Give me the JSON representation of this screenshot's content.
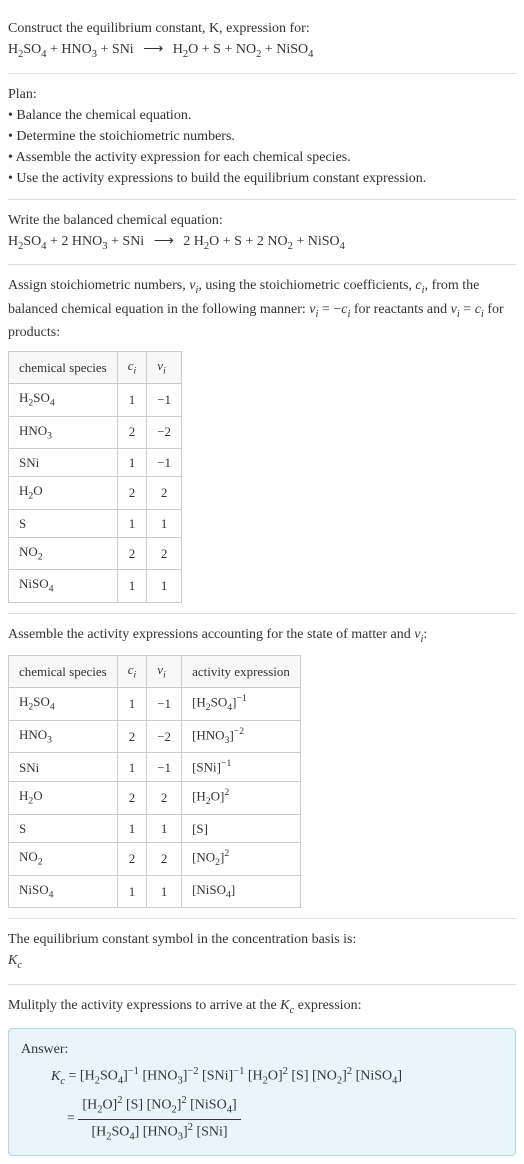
{
  "section1": {
    "line1": "Construct the equilibrium constant, K, expression for:",
    "equation_lhs": "H₂SO₄ + HNO₃ + SNi",
    "equation_rhs": "H₂O + S + NO₂ + NiSO₄"
  },
  "section2": {
    "title": "Plan:",
    "items": [
      "Balance the chemical equation.",
      "Determine the stoichiometric numbers.",
      "Assemble the activity expression for each chemical species.",
      "Use the activity expressions to build the equilibrium constant expression."
    ]
  },
  "section3": {
    "title": "Write the balanced chemical equation:",
    "equation_lhs": "H₂SO₄ + 2 HNO₃ + SNi",
    "equation_rhs": "2 H₂O + S + 2 NO₂ + NiSO₄"
  },
  "section4": {
    "text": "Assign stoichiometric numbers, νᵢ, using the stoichiometric coefficients, cᵢ, from the balanced chemical equation in the following manner: νᵢ = −cᵢ for reactants and νᵢ = cᵢ for products:",
    "headers": [
      "chemical species",
      "cᵢ",
      "νᵢ"
    ],
    "rows": [
      [
        "H₂SO₄",
        "1",
        "−1"
      ],
      [
        "HNO₃",
        "2",
        "−2"
      ],
      [
        "SNi",
        "1",
        "−1"
      ],
      [
        "H₂O",
        "2",
        "2"
      ],
      [
        "S",
        "1",
        "1"
      ],
      [
        "NO₂",
        "2",
        "2"
      ],
      [
        "NiSO₄",
        "1",
        "1"
      ]
    ]
  },
  "section5": {
    "text": "Assemble the activity expressions accounting for the state of matter and νᵢ:",
    "headers": [
      "chemical species",
      "cᵢ",
      "νᵢ",
      "activity expression"
    ],
    "rows": [
      [
        "H₂SO₄",
        "1",
        "−1",
        "[H₂SO₄]⁻¹"
      ],
      [
        "HNO₃",
        "2",
        "−2",
        "[HNO₃]⁻²"
      ],
      [
        "SNi",
        "1",
        "−1",
        "[SNi]⁻¹"
      ],
      [
        "H₂O",
        "2",
        "2",
        "[H₂O]²"
      ],
      [
        "S",
        "1",
        "1",
        "[S]"
      ],
      [
        "NO₂",
        "2",
        "2",
        "[NO₂]²"
      ],
      [
        "NiSO₄",
        "1",
        "1",
        "[NiSO₄]"
      ]
    ]
  },
  "section6": {
    "text": "The equilibrium constant symbol in the concentration basis is:",
    "symbol": "K𝒸"
  },
  "section7": {
    "text": "Mulitply the activity expressions to arrive at the K𝒸 expression:"
  },
  "answer": {
    "label": "Answer:",
    "line1_lhs": "K𝒸 = ",
    "line1_rhs": "[H₂SO₄]⁻¹ [HNO₃]⁻² [SNi]⁻¹ [H₂O]² [S] [NO₂]² [NiSO₄]",
    "line2_eq": "= ",
    "frac_num": "[H₂O]² [S] [NO₂]² [NiSO₄]",
    "frac_den": "[H₂SO₄] [HNO₃]² [SNi]"
  }
}
